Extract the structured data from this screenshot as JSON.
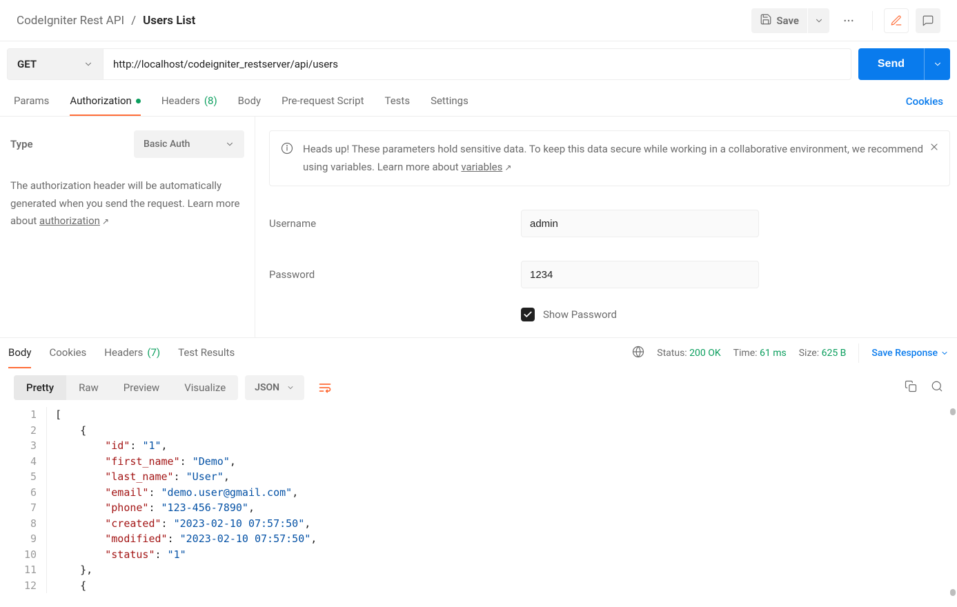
{
  "breadcrumb": {
    "workspace": "CodeIgniter Rest API",
    "item": "Users List"
  },
  "toolbar": {
    "save_label": "Save"
  },
  "request": {
    "method": "GET",
    "url": "http://localhost/codeigniter_restserver/api/users",
    "send_label": "Send"
  },
  "tabs": {
    "params": "Params",
    "authorization": "Authorization",
    "headers_label": "Headers",
    "headers_count": "(8)",
    "body": "Body",
    "prerequest": "Pre-request Script",
    "tests": "Tests",
    "settings": "Settings",
    "cookies": "Cookies"
  },
  "auth": {
    "type_label": "Type",
    "type_value": "Basic Auth",
    "desc_1": "The authorization header will be automatically generated when you send the request. Learn more about ",
    "desc_link": "authorization",
    "alert_text_1": "Heads up! These parameters hold sensitive data. To keep this data secure while working in a collaborative environment, we recommend using variables. Learn more about ",
    "alert_link": "variables",
    "username_label": "Username",
    "username_value": "admin",
    "password_label": "Password",
    "password_value": "1234",
    "show_password_label": "Show Password"
  },
  "response": {
    "tabs": {
      "body": "Body",
      "cookies": "Cookies",
      "headers_label": "Headers",
      "headers_count": "(7)",
      "test_results": "Test Results"
    },
    "status_label": "Status:",
    "status_value": "200 OK",
    "time_label": "Time:",
    "time_value": "61 ms",
    "size_label": "Size:",
    "size_value": "625 B",
    "save_response": "Save Response",
    "views": {
      "pretty": "Pretty",
      "raw": "Raw",
      "preview": "Preview",
      "visualize": "Visualize"
    },
    "format": "JSON",
    "body_json": [
      {
        "id": "1",
        "first_name": "Demo",
        "last_name": "User",
        "email": "demo.user@gmail.com",
        "phone": "123-456-7890",
        "created": "2023-02-10 07:57:50",
        "modified": "2023-02-10 07:57:50",
        "status": "1"
      }
    ],
    "code_lines": [
      {
        "n": 1,
        "indent": 0,
        "html": "<span class='tok-p'>[</span>"
      },
      {
        "n": 2,
        "indent": 1,
        "html": "<span class='tok-p'>{</span>"
      },
      {
        "n": 3,
        "indent": 2,
        "html": "<span class='tok-k'>\"id\"</span><span class='tok-p'>: </span><span class='tok-s'>\"1\"</span><span class='tok-p'>,</span>"
      },
      {
        "n": 4,
        "indent": 2,
        "html": "<span class='tok-k'>\"first_name\"</span><span class='tok-p'>: </span><span class='tok-s'>\"Demo\"</span><span class='tok-p'>,</span>"
      },
      {
        "n": 5,
        "indent": 2,
        "html": "<span class='tok-k'>\"last_name\"</span><span class='tok-p'>: </span><span class='tok-s'>\"User\"</span><span class='tok-p'>,</span>"
      },
      {
        "n": 6,
        "indent": 2,
        "html": "<span class='tok-k'>\"email\"</span><span class='tok-p'>: </span><span class='tok-s'>\"demo.user@gmail.com\"</span><span class='tok-p'>,</span>"
      },
      {
        "n": 7,
        "indent": 2,
        "html": "<span class='tok-k'>\"phone\"</span><span class='tok-p'>: </span><span class='tok-s'>\"123-456-7890\"</span><span class='tok-p'>,</span>"
      },
      {
        "n": 8,
        "indent": 2,
        "html": "<span class='tok-k'>\"created\"</span><span class='tok-p'>: </span><span class='tok-s'>\"2023-02-10 07:57:50\"</span><span class='tok-p'>,</span>"
      },
      {
        "n": 9,
        "indent": 2,
        "html": "<span class='tok-k'>\"modified\"</span><span class='tok-p'>: </span><span class='tok-s'>\"2023-02-10 07:57:50\"</span><span class='tok-p'>,</span>"
      },
      {
        "n": 10,
        "indent": 2,
        "html": "<span class='tok-k'>\"status\"</span><span class='tok-p'>: </span><span class='tok-s'>\"1\"</span>"
      },
      {
        "n": 11,
        "indent": 1,
        "html": "<span class='tok-p'>},</span>"
      },
      {
        "n": 12,
        "indent": 1,
        "html": "<span class='tok-p'>{</span>"
      }
    ]
  }
}
